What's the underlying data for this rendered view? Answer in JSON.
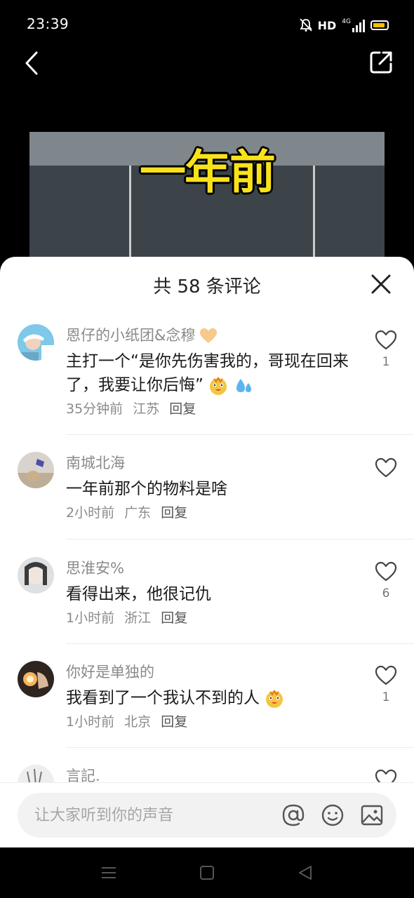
{
  "status_bar": {
    "time": "23:39",
    "hd": "HD",
    "network": "4G"
  },
  "video": {
    "caption": "一年前"
  },
  "sheet": {
    "title": "共 58 条评论",
    "comments": [
      {
        "name": "恩仔的小纸团&念穆",
        "name_emoji": "orange-heart-icon",
        "text": "主打一个“是你先伤害我的，哥现在回来了，我要让你后悔”",
        "text_emojis": [
          "sticker-face-icon",
          "sweat-drops-icon"
        ],
        "time": "35分钟前",
        "location": "江苏",
        "reply": "回复",
        "likes": "1"
      },
      {
        "name": "南城北海",
        "text": "一年前那个的物料是啥",
        "time": "2小时前",
        "location": "广东",
        "reply": "回复",
        "likes": ""
      },
      {
        "name": "思淮安%",
        "text": "看得出来，他很记仇",
        "time": "1小时前",
        "location": "浙江",
        "reply": "回复",
        "likes": "6"
      },
      {
        "name": "你好是单独的",
        "text": "我看到了一个我认不到的人",
        "text_emojis": [
          "sticker-face-icon"
        ],
        "time": "1小时前",
        "location": "北京",
        "reply": "回复",
        "likes": "1"
      },
      {
        "name": "言記."
      }
    ]
  },
  "input": {
    "placeholder": "让大家听到你的声音"
  },
  "colors": {
    "accent_yellow": "#f9e21a",
    "battery": "#f2c200",
    "sheet_bg": "#ffffff",
    "meta_gray": "#8a8a8a"
  }
}
